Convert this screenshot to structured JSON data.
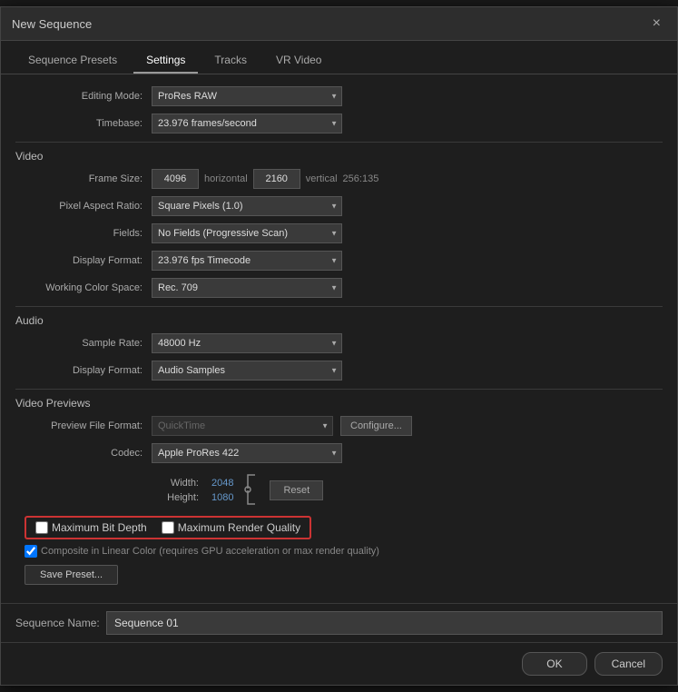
{
  "dialog": {
    "title": "New Sequence",
    "close_label": "×"
  },
  "tabs": [
    {
      "id": "sequence-presets",
      "label": "Sequence Presets",
      "active": false
    },
    {
      "id": "settings",
      "label": "Settings",
      "active": true
    },
    {
      "id": "tracks",
      "label": "Tracks",
      "active": false
    },
    {
      "id": "vr-video",
      "label": "VR Video",
      "active": false
    }
  ],
  "settings": {
    "editing_mode_label": "Editing Mode:",
    "editing_mode_value": "ProRes RAW",
    "timebase_label": "Timebase:",
    "timebase_value": "23.976 frames/second",
    "video_section_label": "Video",
    "frame_size_label": "Frame Size:",
    "frame_size_h": "4096",
    "frame_size_h_label": "horizontal",
    "frame_size_v": "2160",
    "frame_size_v_label": "vertical",
    "frame_size_ratio": "256:135",
    "pixel_aspect_label": "Pixel Aspect Ratio:",
    "pixel_aspect_value": "Square Pixels (1.0)",
    "fields_label": "Fields:",
    "fields_value": "No Fields (Progressive Scan)",
    "display_format_label": "Display Format:",
    "display_format_value": "23.976 fps Timecode",
    "working_color_label": "Working Color Space:",
    "working_color_value": "Rec. 709",
    "audio_section_label": "Audio",
    "sample_rate_label": "Sample Rate:",
    "sample_rate_value": "48000 Hz",
    "audio_display_label": "Display Format:",
    "audio_display_value": "Audio Samples",
    "video_previews_label": "Video Previews",
    "preview_file_label": "Preview File Format:",
    "preview_file_value": "QuickTime",
    "configure_label": "Configure...",
    "codec_label": "Codec:",
    "codec_value": "Apple ProRes 422",
    "width_label": "Width:",
    "width_value": "2048",
    "height_label": "Height:",
    "height_value": "1080",
    "reset_label": "Reset",
    "max_bit_depth_label": "Maximum Bit Depth",
    "max_render_quality_label": "Maximum Render Quality",
    "composite_label": "Composite in Linear Color (requires GPU acceleration or max render quality)",
    "save_preset_label": "Save Preset...",
    "sequence_name_label": "Sequence Name:",
    "sequence_name_value": "Sequence 01",
    "ok_label": "OK",
    "cancel_label": "Cancel"
  }
}
